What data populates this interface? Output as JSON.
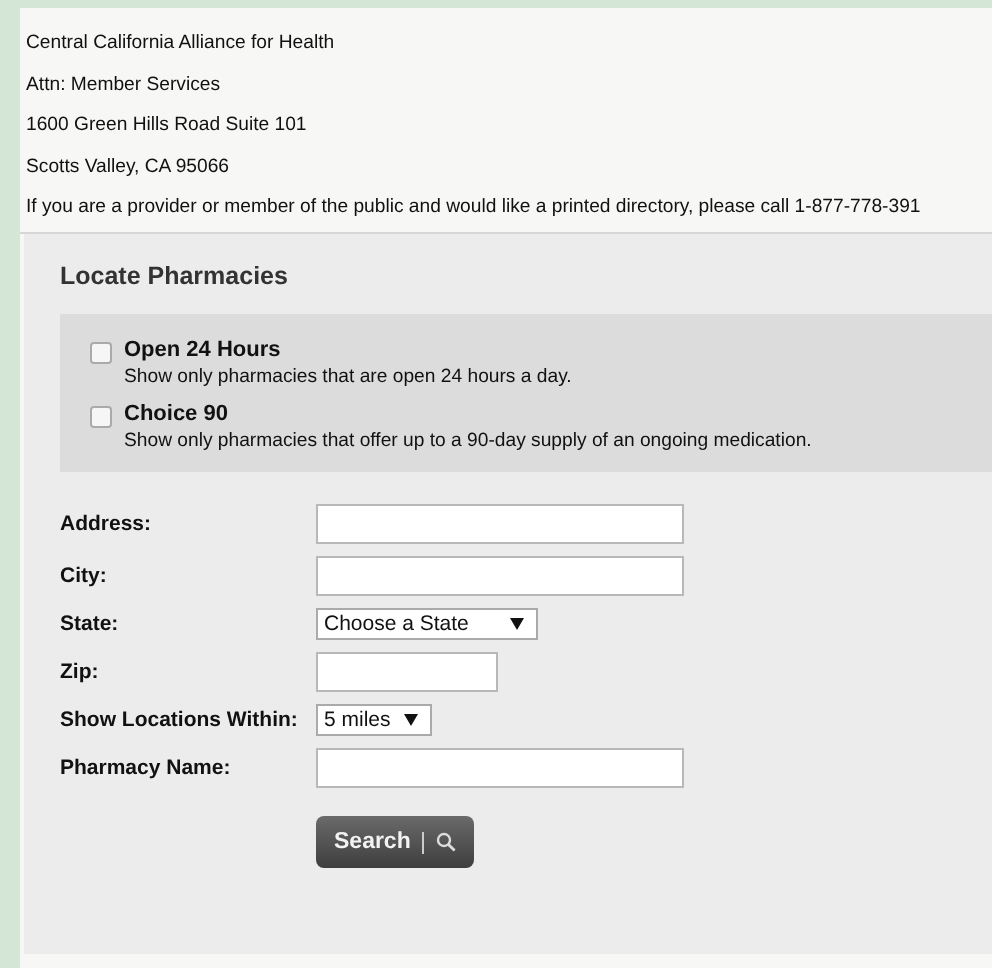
{
  "address_lines": [
    "Central California Alliance for Health",
    "Attn: Member Services",
    "1600 Green Hills Road Suite 101",
    "Scotts Valley, CA 95066",
    "If you are a provider or member of the public and would like a printed directory, please call 1-877-778-391"
  ],
  "panel": {
    "title": "Locate Pharmacies",
    "filters": [
      {
        "label": "Open 24 Hours",
        "description": "Show only pharmacies that are open 24 hours a day.",
        "checked": false
      },
      {
        "label": "Choice 90",
        "description": "Show only pharmacies that offer up to a 90-day supply of an ongoing medication.",
        "checked": false
      }
    ],
    "fields": [
      {
        "label": "Address:",
        "kind": "text"
      },
      {
        "label": "City:",
        "kind": "text"
      },
      {
        "label": "State:",
        "kind": "select",
        "value": "Choose a State"
      },
      {
        "label": "Zip:",
        "kind": "text"
      },
      {
        "label": "Show Locations Within:",
        "kind": "select",
        "value": "5 miles"
      },
      {
        "label": "Pharmacy Name:",
        "kind": "text"
      }
    ],
    "search_button": "Search"
  }
}
